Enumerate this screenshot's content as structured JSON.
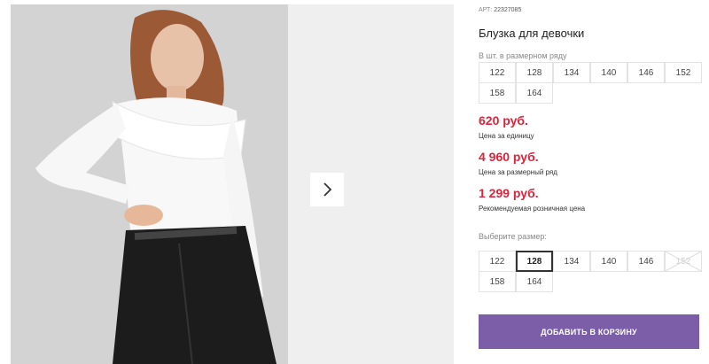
{
  "product": {
    "article_label": "АРТ:",
    "article_value": "22327085",
    "title": "Блузка для девочки"
  },
  "sizes_in_row": {
    "label": "В шт. в размерном ряду",
    "sizes": [
      "122",
      "128",
      "134",
      "140",
      "146",
      "152",
      "158",
      "164"
    ]
  },
  "prices": [
    {
      "value": "620 руб.",
      "label": "Цена за единицу"
    },
    {
      "value": "4 960 руб.",
      "label": "Цена за размерный ряд"
    },
    {
      "value": "1 299 руб.",
      "label": "Рекомендуемая розничная цена"
    }
  ],
  "size_select": {
    "label": "Выберите размер:",
    "sizes": [
      "122",
      "128",
      "134",
      "140",
      "146",
      "152",
      "158",
      "164"
    ],
    "selected": "128",
    "unavailable": [
      "152"
    ]
  },
  "cart_button": "ДОБАВИТЬ В КОРЗИНУ",
  "icons": {
    "next": "chevron-right-icon"
  },
  "colors": {
    "accent": "#7b5ea7",
    "price": "#d7263d"
  }
}
